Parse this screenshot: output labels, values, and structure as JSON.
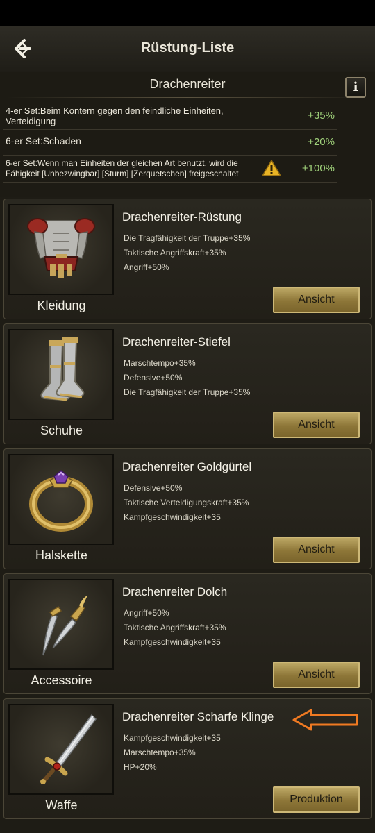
{
  "header": {
    "title": "Rüstung-Liste"
  },
  "set": {
    "name": "Drachenreiter",
    "bonuses": [
      {
        "text": "4-er Set:Beim Kontern gegen den feindliche Einheiten, Verteidigung",
        "value": "+35%"
      },
      {
        "text": "6-er Set:Schaden",
        "value": "+20%"
      },
      {
        "text": "6-er Set:Wenn man Einheiten der gleichen Art benutzt, wird die Fähigkeit [Unbezwingbar] [Sturm] [Zerquetschen] freigeschaltet",
        "value": "+100%"
      }
    ]
  },
  "items": [
    {
      "slot": "Kleidung",
      "name": "Drachenreiter-Rüstung",
      "stats": [
        "Die Tragfähigkeit der Truppe+35%",
        "Taktische Angriffskraft+35%",
        "Angriff+50%"
      ],
      "button": "Ansicht",
      "icon": "armor-icon"
    },
    {
      "slot": "Schuhe",
      "name": "Drachenreiter-Stiefel",
      "stats": [
        "Marschtempo+35%",
        "Defensive+50%",
        "Die Tragfähigkeit der Truppe+35%"
      ],
      "button": "Ansicht",
      "icon": "boots-icon"
    },
    {
      "slot": "Halskette",
      "name": "Drachenreiter Goldgürtel",
      "stats": [
        "Defensive+50%",
        "Taktische Verteidigungskraft+35%",
        "Kampfgeschwindigkeit+35"
      ],
      "button": "Ansicht",
      "icon": "ring-icon"
    },
    {
      "slot": "Accessoire",
      "name": "Drachenreiter Dolch",
      "stats": [
        "Angriff+50%",
        "Taktische Angriffskraft+35%",
        "Kampfgeschwindigkeit+35"
      ],
      "button": "Ansicht",
      "icon": "dagger-icon"
    },
    {
      "slot": "Waffe",
      "name": "Drachenreiter Scharfe Klinge",
      "stats": [
        "Kampfgeschwindigkeit+35",
        "Marschtempo+35%",
        "HP+20%"
      ],
      "button": "Produktion",
      "icon": "sword-icon"
    }
  ],
  "colors": {
    "accent_gold": "#bca764",
    "bonus_green": "#9fd07a",
    "annotation_orange": "#f07a22"
  }
}
